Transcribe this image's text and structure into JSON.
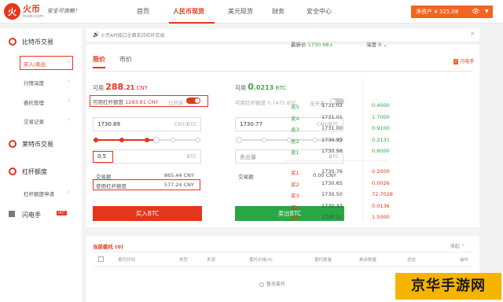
{
  "brand": {
    "logo_char": "火",
    "name": "火币",
    "domain": "huobi.com",
    "slogan": "安全可信赖！"
  },
  "nav": [
    "首页",
    "人民币现货",
    "美元现货",
    "财务",
    "安全中心"
  ],
  "asset": {
    "label": "净资产 ¥ 325.08",
    "eye": "👁",
    "caret": "▼"
  },
  "sidebar": {
    "section1": "比特币交易",
    "items1": [
      "买入/卖出",
      "行情深度",
      "委托管理",
      "交易记录"
    ],
    "section2": "莱特币交易",
    "section3": "杠杆额度",
    "items3": [
      "杠杆额度申请"
    ],
    "section4": "闪电手",
    "hot": "HOT",
    "chevron": "›"
  },
  "notice": {
    "icon": "🔊",
    "text": "火币API接口全面支持杠杆交易",
    "close": "×"
  },
  "tabs": [
    "限价",
    "市价"
  ],
  "lightning": {
    "badge": "⚡",
    "label": "闪电手"
  },
  "buy": {
    "avail_label": "可用",
    "avail_int": "288",
    "avail_dec": ".21",
    "avail_unit": "CNY",
    "lev_label": "可用杠杆额度",
    "lev_amount": "1293.81 CNY",
    "lev_toggle_label": "已开启",
    "price": "1730.89",
    "price_unit": "CNY/BTC",
    "amount": "0.5",
    "amount_unit": "BTC",
    "deal_label": "交易额",
    "deal_value": "865.44 CNY",
    "use_label": "使用杠杆额度",
    "use_value": "577.24 CNY",
    "button": "买入BTC",
    "slider_percent": 56
  },
  "sell": {
    "avail_label": "可用",
    "avail_int": "0",
    "avail_dec": ".0213",
    "avail_unit": "BTC",
    "lev_label": "可用杠杆额度 0.7475 BTC",
    "lev_toggle_label": "未开启",
    "price": "1730.77",
    "price_unit": "CNY/BTC",
    "amount_placeholder": "卖出量",
    "amount_unit": "BTC",
    "deal_label": "交易额",
    "deal_value": "0.00 CNY",
    "button": "卖出BTC",
    "slider_percent": 0
  },
  "book": {
    "latest_label": "最新价",
    "latest_price": "1730.98",
    "latest_arrow": "↓",
    "depth_label": "深度 0",
    "depth_caret": "⌄",
    "bids": [
      {
        "label": "卖5",
        "price": "1731.02",
        "amount": "0.4000"
      },
      {
        "label": "卖4",
        "price": "1731.01",
        "amount": "1.7000"
      },
      {
        "label": "卖3",
        "price": "1731.00",
        "amount": "0.9100"
      },
      {
        "label": "卖2",
        "price": "1730.99",
        "amount": "0.2131"
      },
      {
        "label": "卖1",
        "price": "1730.98",
        "amount": "0.8000"
      }
    ],
    "asks": [
      {
        "label": "买1",
        "price": "1730.76",
        "amount": "0.2000"
      },
      {
        "label": "买2",
        "price": "1730.65",
        "amount": "0.0026"
      },
      {
        "label": "买3",
        "price": "1730.50",
        "amount": "72.7028"
      },
      {
        "label": "买4",
        "price": "1730.33",
        "amount": "0.0136"
      },
      {
        "label": "买5",
        "price": "1730.21",
        "amount": "1.5000"
      }
    ]
  },
  "orders": {
    "title": "当前委托 (0)",
    "more": "收起 ⌃",
    "headers": [
      "委托时间",
      "类型",
      "来源",
      "委托价格(¥)",
      "委托数量",
      "剩余数量",
      "状态",
      "操作"
    ],
    "empty": "暂无委托"
  },
  "watermark": "京华手游网",
  "colors": {
    "brand": "#e5361c",
    "sell": "#29a744",
    "asset": "#f26422",
    "watermark": "#f5b400"
  }
}
